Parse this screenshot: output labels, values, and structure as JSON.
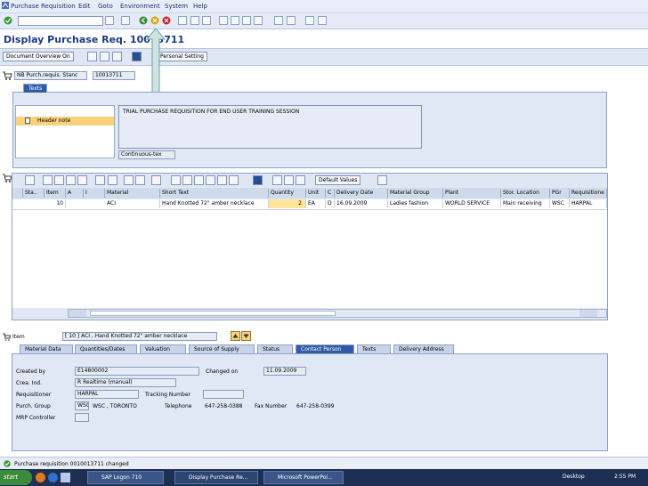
{
  "menu": [
    "Purchase Requisition",
    "Edit",
    "Goto",
    "Environment",
    "System",
    "Help"
  ],
  "title": "Display Purchase Req. 10013711",
  "toolbar": {
    "doc_overview": "Document Overview On",
    "personal_setting": "Personal Setting"
  },
  "header": {
    "doc_type": "NB Purch.requis. Stanc",
    "doc_number": "10013711"
  },
  "texts": {
    "tab_label": "Texts",
    "header_note": "Header note",
    "note_text": "TRIAL PURCHASE REQUISITION FOR END USER TRAINING SESSION",
    "format": "Continuous-tex"
  },
  "grid": {
    "default_values": "Default Values",
    "columns": [
      "Sta..",
      "Item",
      "A",
      "I",
      "Material",
      "Short Text",
      "Quantity",
      "Unit",
      "C",
      "Delivery Date",
      "Material Group",
      "Plant",
      "Stor. Location",
      "PGr",
      "Requisitione"
    ],
    "rows": [
      [
        "",
        "10",
        "",
        "",
        "ACI",
        "Hand Knotted 72\" amber necklace",
        "2",
        "EA",
        "D",
        "16.09.2009",
        "Ladies fashion",
        "WORLD SERVICE",
        "Main receiving",
        "WSC",
        "HARPAL"
      ]
    ]
  },
  "item": {
    "label": "Item",
    "selector": "[ 10 ] ACI , Hand Knotted 72\" amber necklace"
  },
  "item_tabs": [
    "Material Data",
    "Quantities/Dates",
    "Valuation",
    "Source of Supply",
    "Status",
    "Contact Person",
    "Texts",
    "Delivery Address"
  ],
  "active_tab": "Contact Person",
  "contact": {
    "created_by_label": "Created by",
    "created_by": "E14800002",
    "changed_on_label": "Changed on",
    "changed_on": "11.09.2009",
    "crea_ind_label": "Crea. Ind.",
    "crea_ind": "R Realtime (manual)",
    "requisitioner_label": "Requisitioner",
    "requisitioner": "HARPAL",
    "tracking_label": "Tracking Number",
    "tracking": "",
    "purch_group_label": "Purch. Group",
    "purch_group_code": "WSC",
    "purch_group_name": "WSC , TORONTO",
    "telephone_label": "Telephone",
    "telephone": "647-258-0388",
    "fax_label": "Fax Number",
    "fax": "647-258-0399",
    "mrp_label": "MRP Controller",
    "mrp": ""
  },
  "status": "Purchase requisition 0010013711 changed",
  "taskbar": {
    "start": "start",
    "tasks": [
      "SAP Logon 710",
      "Display Purchase Re...",
      "Microsoft PowerPoi..."
    ],
    "desktop": "Desktop",
    "time": "2:55 PM"
  }
}
